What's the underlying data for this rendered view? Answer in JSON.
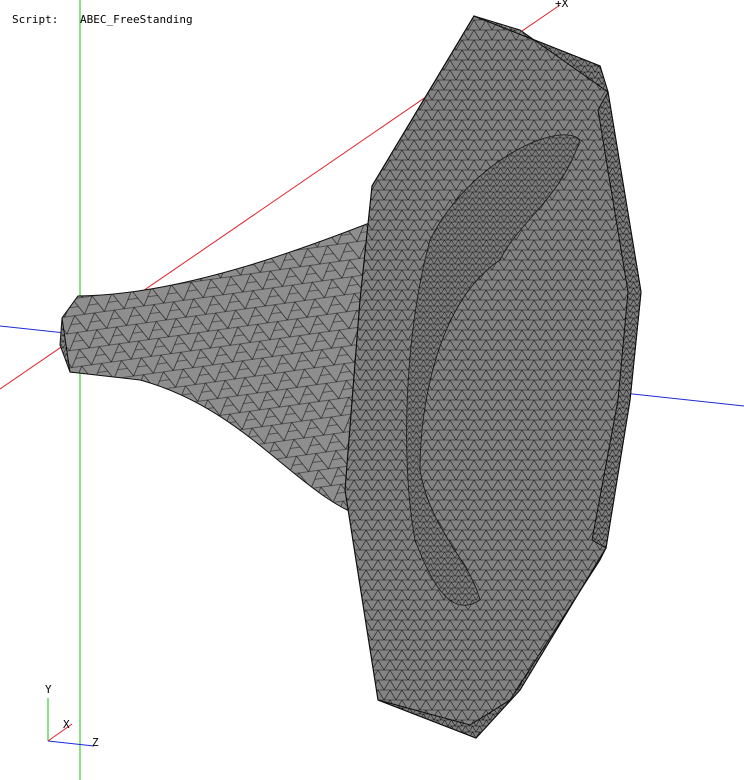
{
  "hud": {
    "script_label": "Script:",
    "script_name": "ABEC_FreeStanding"
  },
  "axes": {
    "x_label": "+X",
    "gizmo": {
      "y_label": "Y",
      "x_label": "X",
      "z_label": "Z"
    }
  },
  "colors": {
    "background": "#ffffff",
    "mesh_fill": "#8c8c8c",
    "mesh_fill_dark": "#6f6f6f",
    "mesh_lines": "#111111",
    "axis_x": "#e0202a",
    "axis_y": "#19c219",
    "axis_z": "#1c2bd8"
  }
}
